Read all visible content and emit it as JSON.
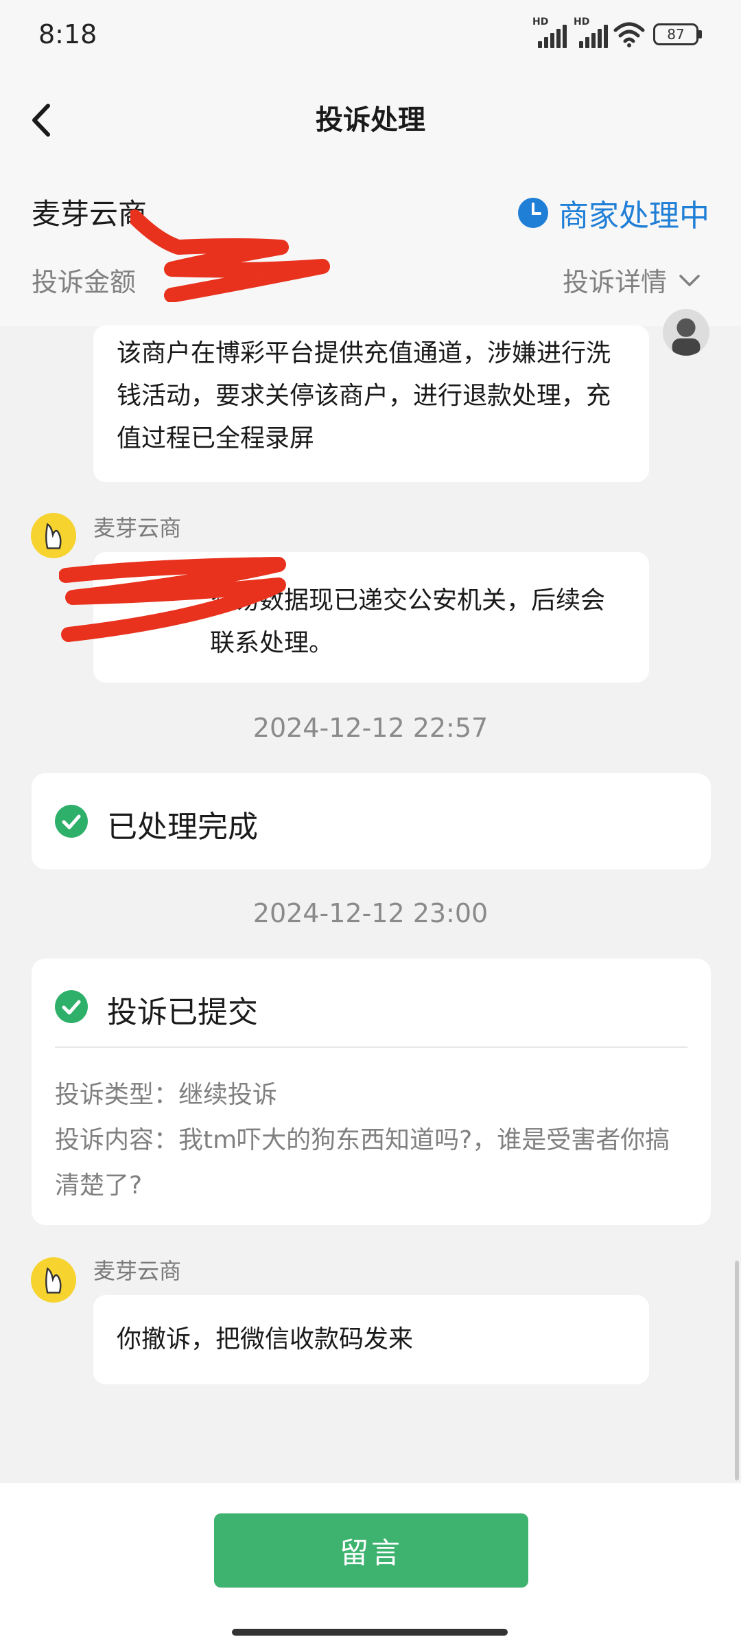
{
  "status_bar": {
    "time": "8:18",
    "battery": "87",
    "hd_label": "HD"
  },
  "header": {
    "title": "投诉处理",
    "merchant": "麦芽云商",
    "status": "商家处理中",
    "amount_label": "投诉金额",
    "details": "投诉详情"
  },
  "messages": [
    {
      "text": "该商户在博彩平台提供充值通道，涉嫌进行洗钱活动，要求关停该商户，进行退款处理，充值过程已全程录屏"
    },
    {
      "sender": "麦芽云商",
      "text": "交易数据现已递交公安机关，后续会联系处理。"
    }
  ],
  "timeline": [
    {
      "timestamp": "2024-12-12 22:57",
      "title": "已处理完成"
    },
    {
      "timestamp": "2024-12-12 23:00",
      "title": "投诉已提交",
      "type_line": "投诉类型：继续投诉",
      "content_line": "投诉内容：我tm吓大的狗东西知道吗?，谁是受害者你搞清楚了?"
    }
  ],
  "last_message": {
    "sender": "麦芽云商",
    "text": "你撤诉，把微信收款码发来"
  },
  "bottom": {
    "button_label": "留言"
  },
  "colors": {
    "accent_green": "#3eb370",
    "status_blue": "#1f7ed6",
    "check_green": "#2fb06a"
  }
}
